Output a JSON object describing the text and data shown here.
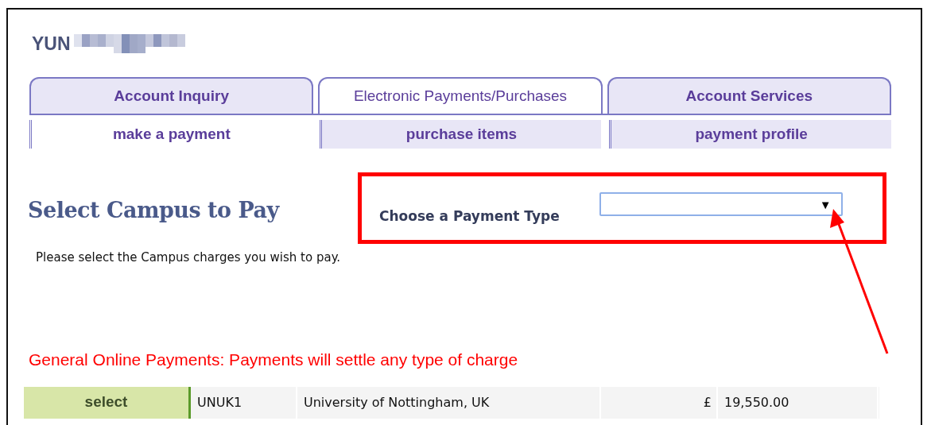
{
  "user_name": "YUN",
  "tabs": [
    {
      "label": "Account Inquiry",
      "selected": false
    },
    {
      "label": "Electronic Payments/Purchases",
      "selected": true
    },
    {
      "label": "Account Services",
      "selected": false
    }
  ],
  "subtabs": [
    {
      "label": "make a payment",
      "selected": true
    },
    {
      "label": "purchase items",
      "selected": false
    },
    {
      "label": "payment profile",
      "selected": false
    }
  ],
  "heading": "Select Campus to Pay",
  "payment_type": {
    "label": "Choose a Payment Type",
    "arrow": "▼"
  },
  "instructions": "Please select the Campus charges you wish to pay.",
  "section_title": "General Online Payments: Payments will settle any type of charge",
  "rows": [
    {
      "action": "select",
      "code": "UNUK1",
      "campus": "University of Nottingham, UK",
      "currency": "£",
      "amount": "19,550.00"
    }
  ]
}
